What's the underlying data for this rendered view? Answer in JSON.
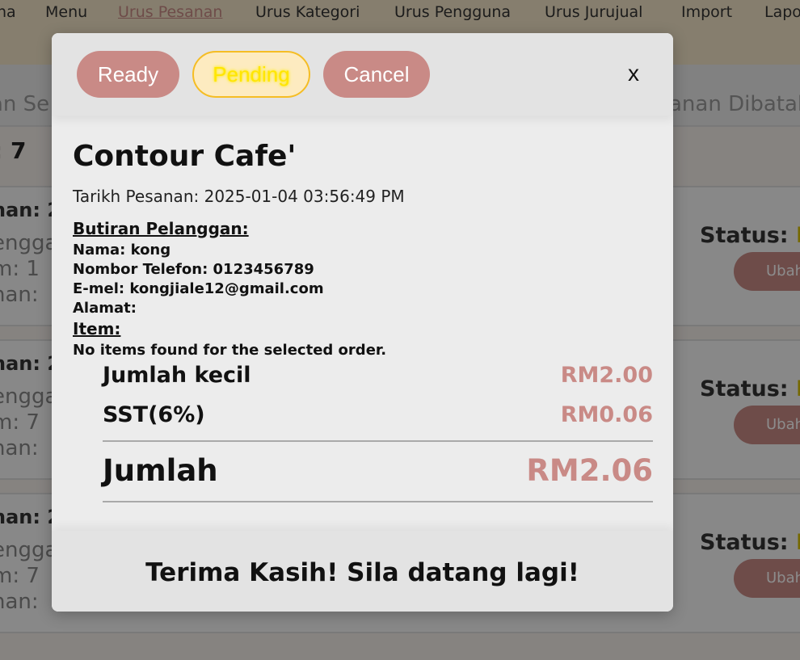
{
  "nav": {
    "items": [
      "na",
      "Menu",
      "Urus Pesanan",
      "Urus Kategori",
      "Urus Pengguna",
      "Urus Jurujual",
      "Import",
      "Lapo"
    ]
  },
  "background": {
    "subbar_left": "an Se",
    "subbar_right": "anan Dibatal",
    "count_label": ": 7",
    "cards": [
      {
        "line1": "nan: 20",
        "line2": "engga",
        "line3": "m: 1",
        "line4": "nan:",
        "status_label": "Status:",
        "status_value": "Pe",
        "button": "Ubah"
      },
      {
        "line1": "nan: 20",
        "line2": "engga",
        "line3": "m: 7",
        "line4": "nan:",
        "status_label": "Status:",
        "status_value": "Pe",
        "button": "Ubah"
      },
      {
        "line1": "nan: 20",
        "line2": "engga",
        "line3": "m: 7",
        "line4": "nan:",
        "status_label": "Status:",
        "status_value": "Pe",
        "button": "Ubah"
      }
    ]
  },
  "modal": {
    "buttons": {
      "ready": "Ready",
      "pending": "Pending",
      "cancel": "Cancel",
      "close": "x"
    },
    "shop_name": "Contour Cafe'",
    "order_date": "Tarikh Pesanan: 2025-01-04 03:56:49 PM",
    "customer": {
      "heading": "Butiran Pelanggan:",
      "name": "Nama: kong",
      "phone": "Nombor Telefon: 0123456789",
      "email": "E-mel: kongjiale12@gmail.com",
      "address": "Alamat:"
    },
    "items": {
      "heading": "Item:",
      "empty_message": "No items found for the selected order."
    },
    "summary": {
      "subtotal_label": "Jumlah kecil",
      "subtotal_value": "RM2.00",
      "tax_label": "SST(6%)",
      "tax_value": "RM0.06",
      "total_label": "Jumlah",
      "total_value": "RM2.06"
    },
    "footer": "Terima Kasih! Sila datang lagi!"
  },
  "colors": {
    "accent": "#c98a86",
    "pending_bg": "#fdebc0",
    "pending_border": "#f5bd24",
    "pending_text": "#ffe600"
  }
}
